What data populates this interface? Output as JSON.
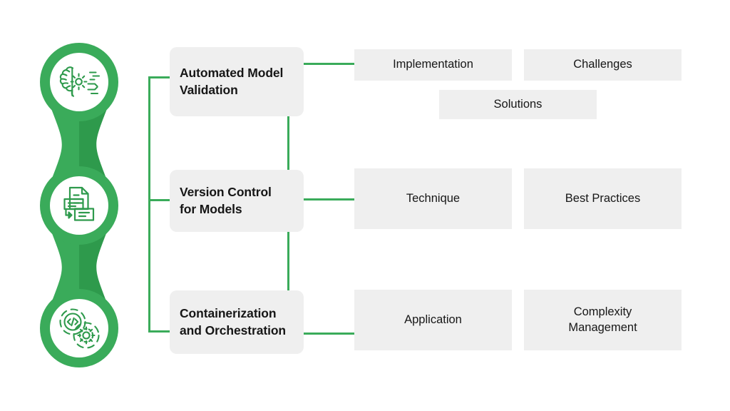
{
  "theme": {
    "background": "#ffffff",
    "accent_green": "#3aab5a",
    "accent_green_dark": "#2e9a4c",
    "box_gray": "#efefef",
    "text_dark": "#161616"
  },
  "diagram": {
    "type": "tree-breakdown",
    "nodes": [
      {
        "id": "automated-model-validation",
        "icon": "brain-gear-circuit-icon",
        "label": "Automated Model\nValidation",
        "label_line1": "Automated Model",
        "label_line2": "Validation",
        "details": [
          "Implementation",
          "Challenges",
          "Solutions"
        ]
      },
      {
        "id": "version-control-for-models",
        "icon": "document-versions-icon",
        "label": "Version Control\nfor Models",
        "label_line1": "Version Control",
        "label_line2": "for Models",
        "details": [
          "Technique",
          "Best Practices"
        ]
      },
      {
        "id": "containerization-and-orchestration",
        "icon": "code-gear-orchestration-icon",
        "label": "Containerization\nand Orchestration",
        "label_line1": "Containerization",
        "label_line2": "and Orchestration",
        "details": [
          "Application",
          "Complexity Management"
        ]
      }
    ],
    "detail_cells": [
      {
        "row": 1,
        "col": 1,
        "text": "Implementation"
      },
      {
        "row": 1,
        "col": 2,
        "text": "Challenges"
      },
      {
        "row": 1,
        "col": 3,
        "text": "Solutions"
      },
      {
        "row": 2,
        "col": 1,
        "text": "Technique"
      },
      {
        "row": 2,
        "col": 2,
        "text": "Best Practices"
      },
      {
        "row": 3,
        "col": 1,
        "text": "Application"
      },
      {
        "row": 3,
        "col": 2,
        "text": "Complexity\nManagement"
      },
      {
        "row": 3,
        "col": 2,
        "text_line1": "Complexity",
        "text_line2": "Management"
      }
    ]
  }
}
